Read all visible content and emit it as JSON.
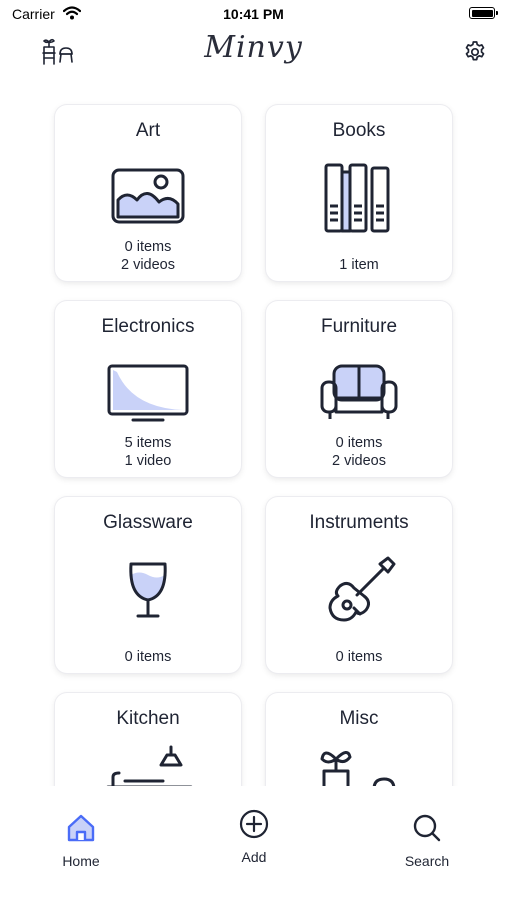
{
  "status_bar": {
    "carrier": "Carrier",
    "time": "10:41 PM"
  },
  "header": {
    "logo": "Minvy",
    "left_icon": "decor-icon",
    "right_icon": "gear-icon"
  },
  "categories": [
    {
      "name": "Art",
      "line1": "0 items",
      "line2": "2 videos",
      "icon": "picture-icon"
    },
    {
      "name": "Books",
      "line1": "",
      "line2": "1 item",
      "icon": "books-icon"
    },
    {
      "name": "Electronics",
      "line1": "5 items",
      "line2": "1 video",
      "icon": "tv-icon"
    },
    {
      "name": "Furniture",
      "line1": "0 items",
      "line2": "2 videos",
      "icon": "sofa-icon"
    },
    {
      "name": "Glassware",
      "line1": "",
      "line2": "0 items",
      "icon": "wine-glass-icon"
    },
    {
      "name": "Instruments",
      "line1": "",
      "line2": "0 items",
      "icon": "guitar-icon"
    },
    {
      "name": "Kitchen",
      "line1": "",
      "line2": "",
      "icon": "kitchen-icon"
    },
    {
      "name": "Misc",
      "line1": "",
      "line2": "",
      "icon": "plant-icon"
    }
  ],
  "tabs": [
    {
      "label": "Home",
      "icon": "home-icon",
      "active": true
    },
    {
      "label": "Add",
      "icon": "add-circle-icon",
      "active": false
    },
    {
      "label": "Search",
      "icon": "search-icon",
      "active": false
    }
  ],
  "colors": {
    "accent": "#4a6cf7",
    "icon_fill": "#c9d2f8",
    "ink": "#1f2433"
  }
}
